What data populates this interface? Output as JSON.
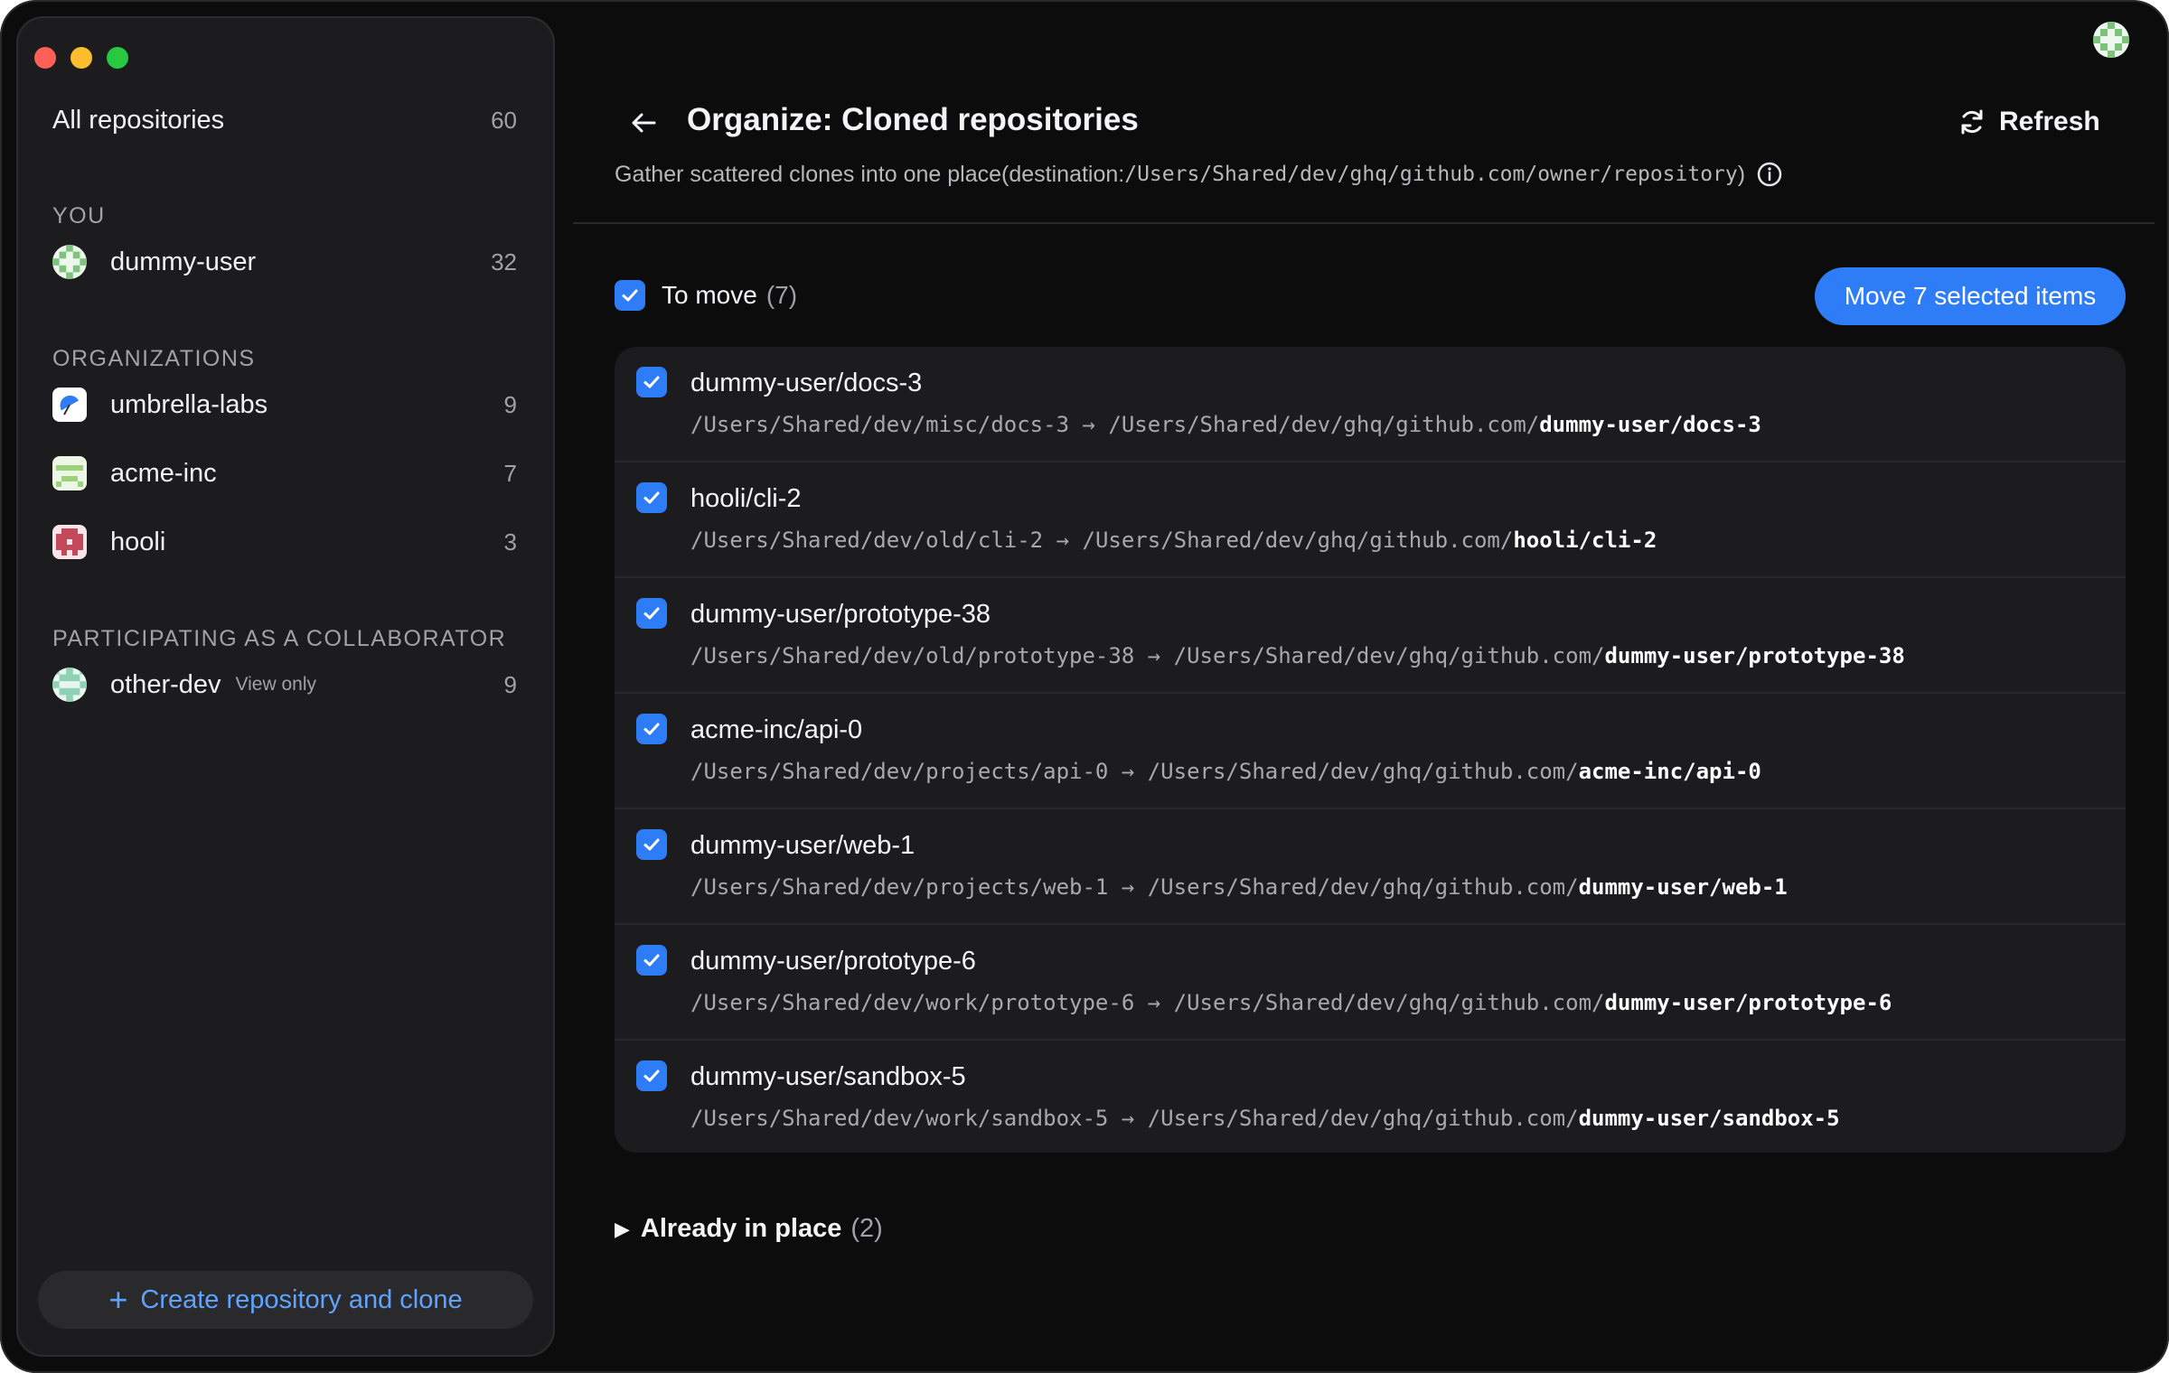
{
  "sidebar": {
    "all_repos": {
      "label": "All repositories",
      "count": "60"
    },
    "you_heading": "YOU",
    "you_items": [
      {
        "label": "dummy-user",
        "count": "32",
        "avatar": "identicon-green"
      }
    ],
    "org_heading": "ORGANIZATIONS",
    "orgs": [
      {
        "label": "umbrella-labs",
        "count": "9",
        "avatar": "umbrella-icon"
      },
      {
        "label": "acme-inc",
        "count": "7",
        "avatar": "identicon-lime"
      },
      {
        "label": "hooli",
        "count": "3",
        "avatar": "identicon-red"
      }
    ],
    "collab_heading": "PARTICIPATING AS A COLLABORATOR",
    "collab_items": [
      {
        "label": "other-dev",
        "badge": "View only",
        "count": "9",
        "avatar": "identicon-mint"
      }
    ],
    "create_button": "Create repository and clone"
  },
  "header": {
    "title": "Organize: Cloned repositories",
    "refresh_label": "Refresh",
    "subtitle_prefix": "Gather scattered clones into one place(destination: ",
    "subtitle_path": "/Users/Shared/dev/ghq/github.com/owner/repository",
    "subtitle_suffix": ")"
  },
  "to_move": {
    "label": "To move",
    "count": "(7)",
    "move_button": "Move 7 selected items",
    "items": [
      {
        "name": "dummy-user/docs-3",
        "src": "/Users/Shared/dev/misc/docs-3",
        "arrow": "→",
        "dest_prefix": "/Users/Shared/dev/ghq/github.com/",
        "dest_repo": "dummy-user/docs-3"
      },
      {
        "name": "hooli/cli-2",
        "src": "/Users/Shared/dev/old/cli-2",
        "arrow": "→",
        "dest_prefix": "/Users/Shared/dev/ghq/github.com/",
        "dest_repo": "hooli/cli-2"
      },
      {
        "name": "dummy-user/prototype-38",
        "src": "/Users/Shared/dev/old/prototype-38",
        "arrow": "→",
        "dest_prefix": "/Users/Shared/dev/ghq/github.com/",
        "dest_repo": "dummy-user/prototype-38"
      },
      {
        "name": "acme-inc/api-0",
        "src": "/Users/Shared/dev/projects/api-0",
        "arrow": "→",
        "dest_prefix": "/Users/Shared/dev/ghq/github.com/",
        "dest_repo": "acme-inc/api-0"
      },
      {
        "name": "dummy-user/web-1",
        "src": "/Users/Shared/dev/projects/web-1",
        "arrow": "→",
        "dest_prefix": "/Users/Shared/dev/ghq/github.com/",
        "dest_repo": "dummy-user/web-1"
      },
      {
        "name": "dummy-user/prototype-6",
        "src": "/Users/Shared/dev/work/prototype-6",
        "arrow": "→",
        "dest_prefix": "/Users/Shared/dev/ghq/github.com/",
        "dest_repo": "dummy-user/prototype-6"
      },
      {
        "name": "dummy-user/sandbox-5",
        "src": "/Users/Shared/dev/work/sandbox-5",
        "arrow": "→",
        "dest_prefix": "/Users/Shared/dev/ghq/github.com/",
        "dest_repo": "dummy-user/sandbox-5"
      }
    ]
  },
  "already": {
    "label": "Already in place",
    "count": "(2)"
  },
  "colors": {
    "accent": "#2f7df6",
    "link": "#5ea3ff",
    "background": "#0c0c0d",
    "panel": "#1c1c1e"
  }
}
